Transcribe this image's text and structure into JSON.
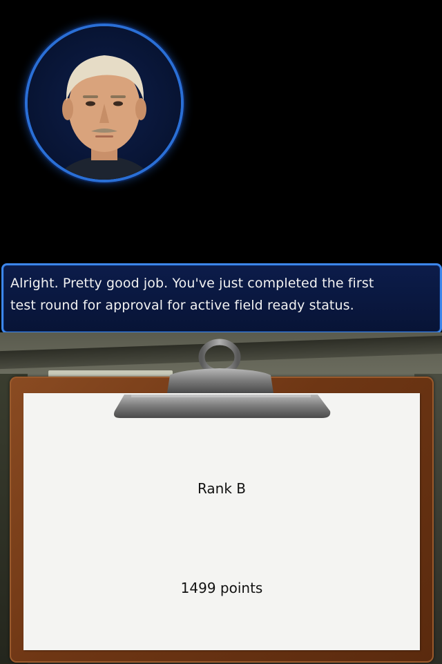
{
  "dialog": {
    "speaker_portrait": "instructor-portrait",
    "text": "Alright. Pretty good job. You've just completed the first\ntest round for approval for active field ready status."
  },
  "results": {
    "rank": "Rank B",
    "points": "1499 points"
  },
  "colors": {
    "dialog_border": "#3d86ea",
    "dialog_bg": "#0c1c4a",
    "portrait_ring": "#2a6fd6",
    "clipboard": "#6e3614",
    "paper": "#f4f4f2"
  }
}
